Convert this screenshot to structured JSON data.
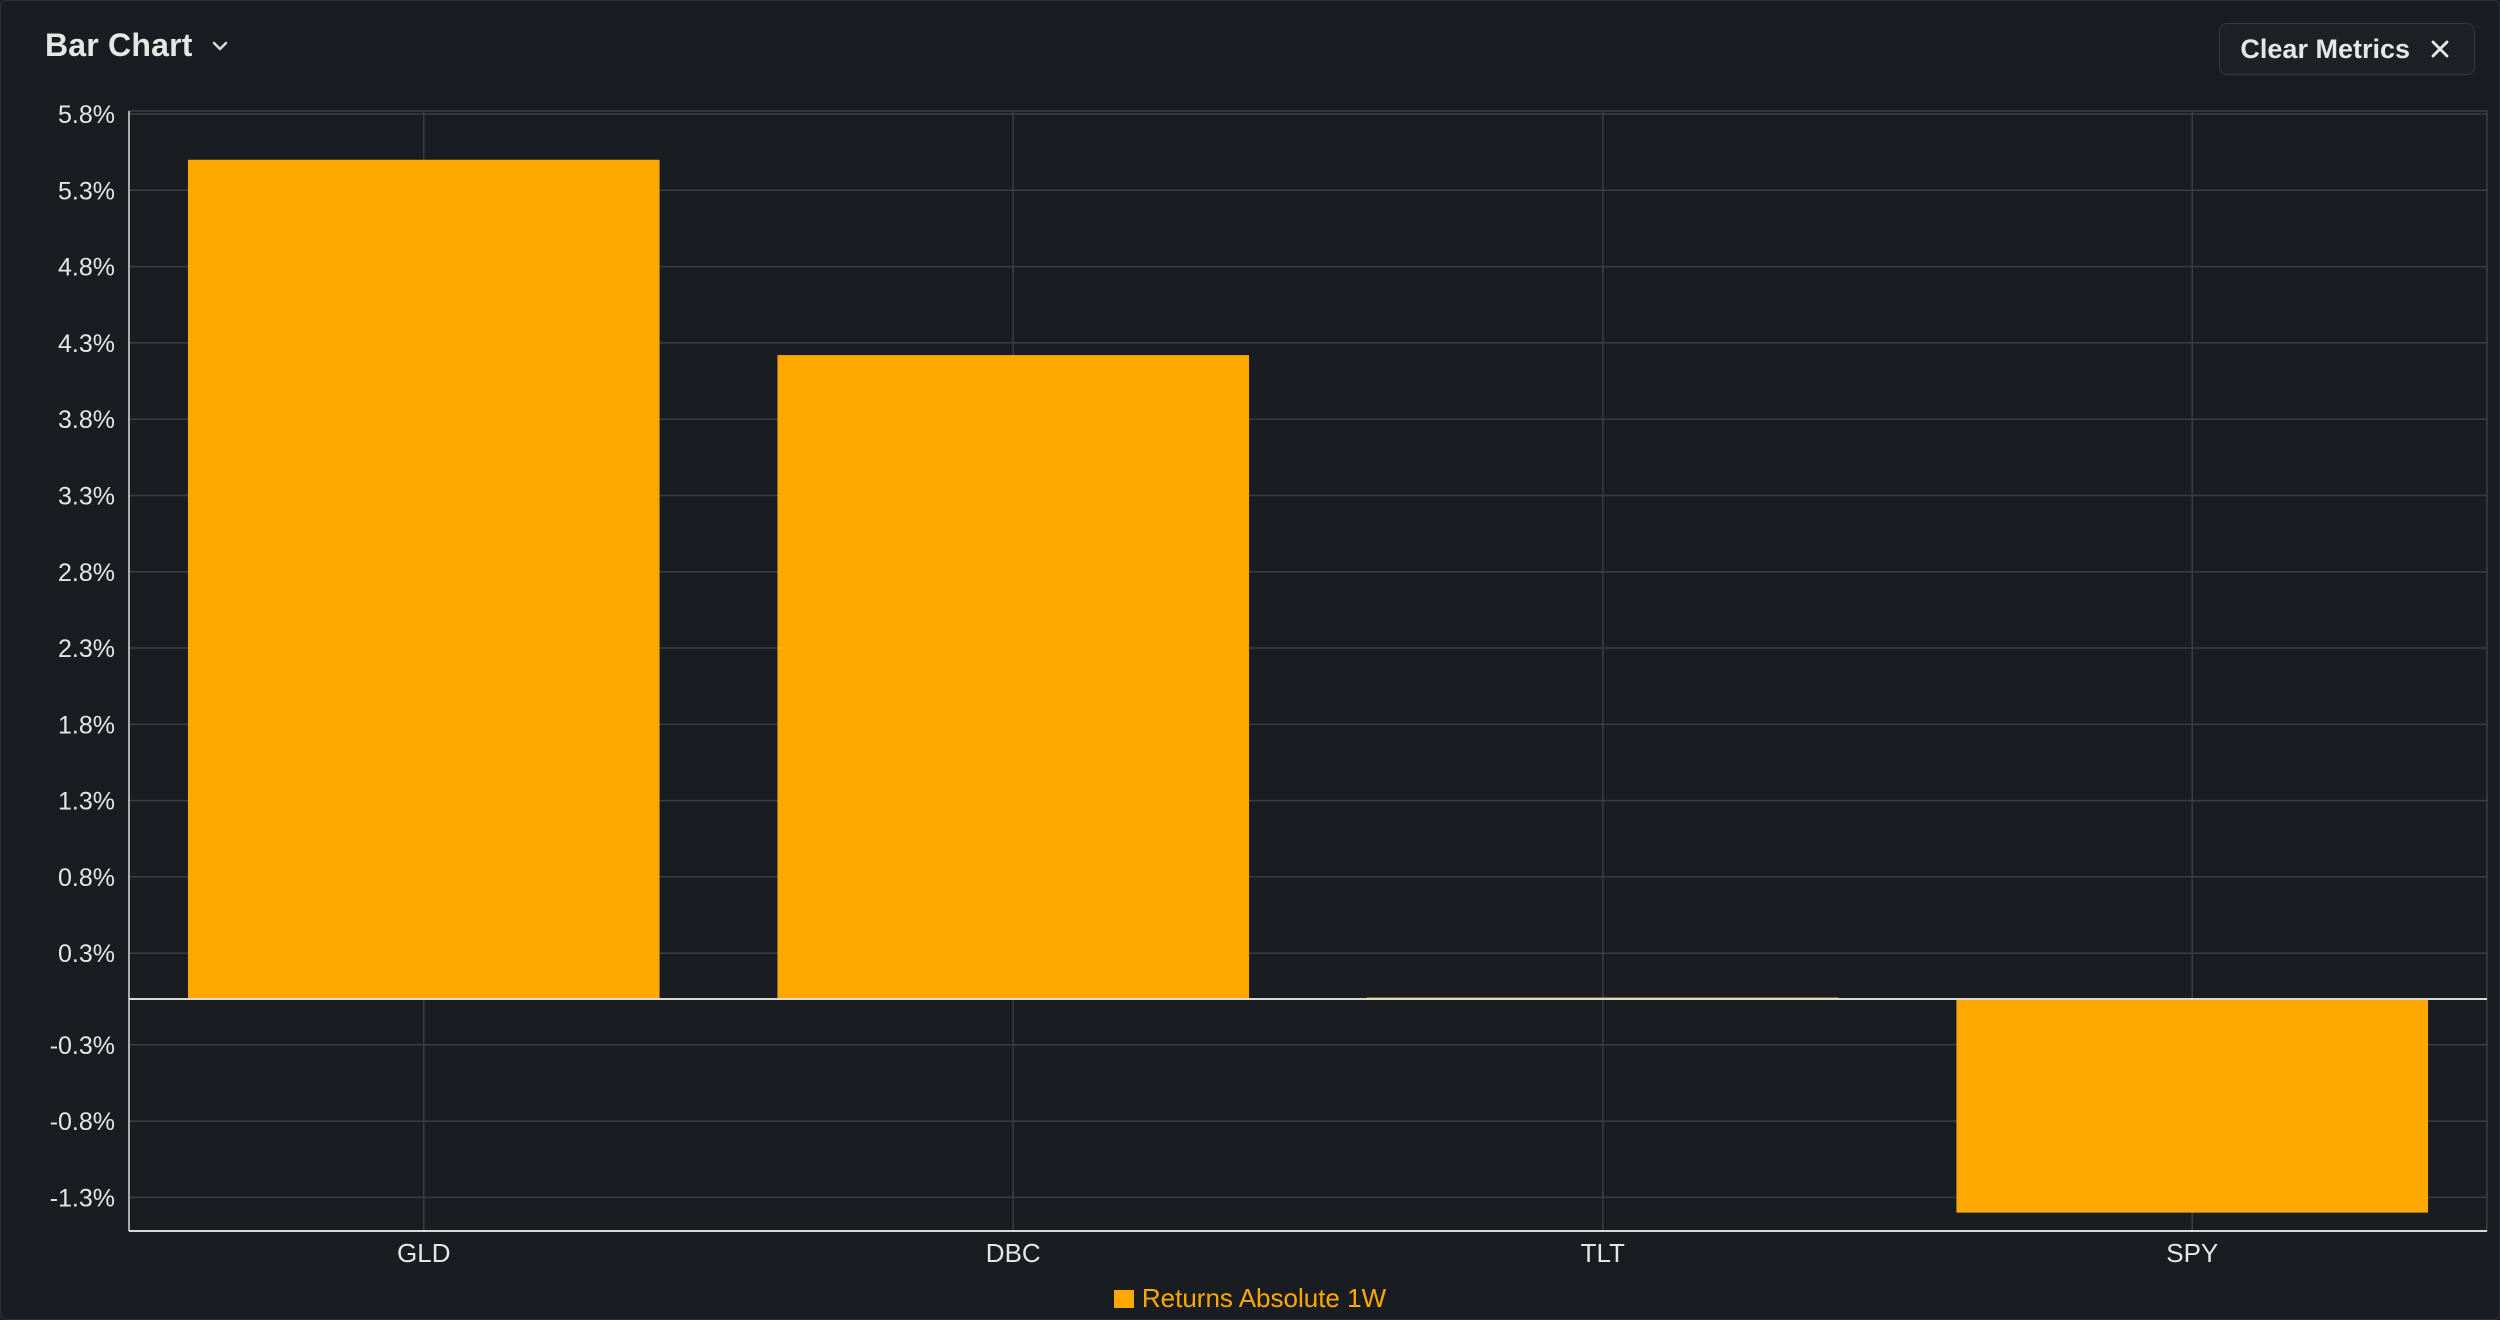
{
  "header": {
    "title": "Bar Chart",
    "clear_label": "Clear Metrics"
  },
  "icons": {
    "dropdown": "chevron-down-icon",
    "clear": "close-icon"
  },
  "colors": {
    "bar": "#ffa800",
    "background": "#191c20",
    "grid": "#3a3e44",
    "axis": "#d8d8d8",
    "text": "#e6e6e6"
  },
  "chart_data": {
    "type": "bar",
    "categories": [
      "GLD",
      "DBC",
      "TLT",
      "SPY"
    ],
    "series": [
      {
        "name": "Returns Absolute 1W",
        "values": [
          5.5,
          4.22,
          0.01,
          -1.4
        ]
      }
    ],
    "ylim": [
      -1.5,
      5.8
    ],
    "yticks": [
      5.8,
      5.3,
      4.8,
      4.3,
      3.8,
      3.3,
      2.8,
      2.3,
      1.8,
      1.3,
      0.8,
      0.3,
      -0.3,
      -0.8,
      -1.3
    ],
    "ytick_labels": [
      "5.8%",
      "5.3%",
      "4.8%",
      "4.3%",
      "3.8%",
      "3.3%",
      "2.8%",
      "2.3%",
      "1.8%",
      "1.3%",
      "0.8%",
      "0.3%",
      "-0.3%",
      "-0.8%",
      "-1.3%"
    ],
    "title": "",
    "xlabel": "",
    "ylabel": "",
    "grid": true,
    "legend": "bottom-center"
  }
}
